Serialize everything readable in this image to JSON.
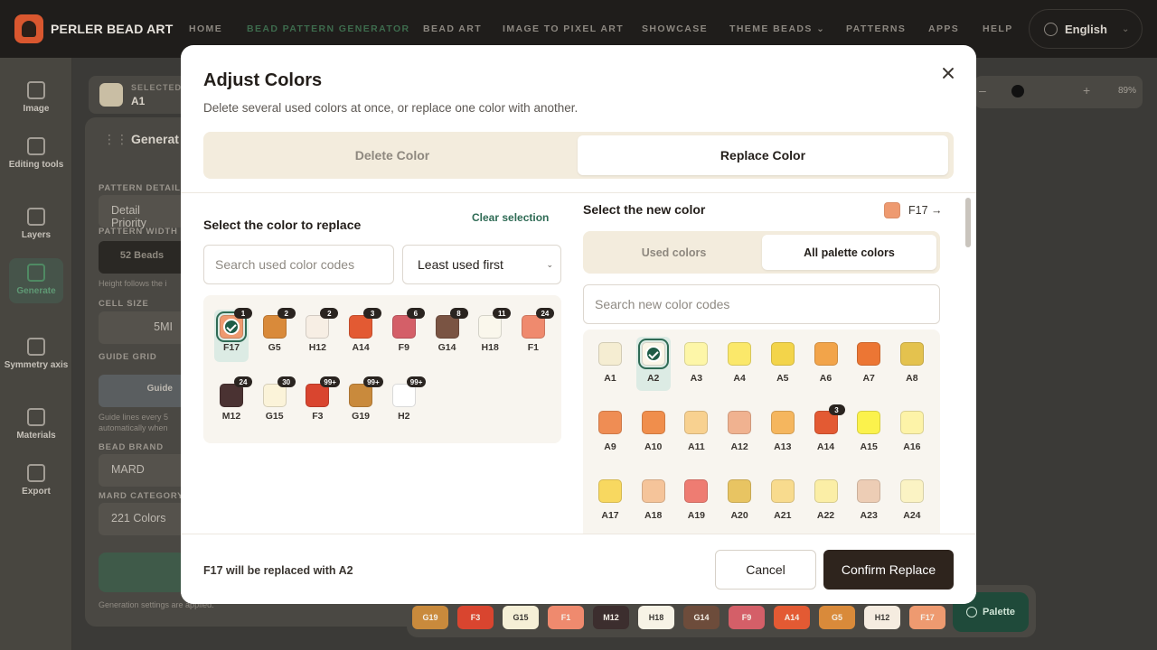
{
  "app": {
    "brand": "PERLER BEAD ART",
    "nav": [
      "HOME",
      "BEAD PATTERN GENERATOR",
      "BEAD ART",
      "IMAGE TO PIXEL ART",
      "SHOWCASE",
      "THEME BEADS",
      "PATTERNS",
      "APPS",
      "HELP"
    ],
    "nav_active": "BEAD PATTERN GENERATOR",
    "language": "English"
  },
  "sidebar": {
    "items": [
      "Image",
      "Editing tools",
      "Layers",
      "Generate",
      "Symmetry axis",
      "Materials",
      "Export"
    ]
  },
  "bg": {
    "selected_label": "SELECTED C",
    "selected_value": "A1",
    "generate_title": "Generat",
    "pattern_detail_label": "PATTERN DETAIL",
    "pattern_detail_value": "Detail Priority",
    "pattern_width_label": "PATTERN WIDTH",
    "pattern_width_value": "52 Beads",
    "height_note": "Height follows the i",
    "cell_size_label": "CELL SIZE",
    "cell_size_value": "5MI",
    "guide_grid_label": "GUIDE GRID",
    "guide_grid_value": "Guide",
    "guide_note": "Guide lines every 5 automatically when",
    "bead_brand_label": "BEAD BRAND",
    "bead_brand_value": "MARD",
    "mard_category_label": "MARD CATEGORY",
    "mard_category_value": "221 Colors",
    "applied_note": "Generation settings are applied.",
    "zoom": "89%"
  },
  "bottom_chips": [
    {
      "code": "G19",
      "color": "#c98a3c"
    },
    {
      "code": "F3",
      "color": "#d9452f"
    },
    {
      "code": "G15",
      "color": "#f5efd6"
    },
    {
      "code": "F1",
      "color": "#ef8a6e"
    },
    {
      "code": "M12",
      "color": "#3c2e2e"
    },
    {
      "code": "H18",
      "color": "#f7f3e6"
    },
    {
      "code": "G14",
      "color": "#6d4c3b"
    },
    {
      "code": "F9",
      "color": "#d45f68"
    },
    {
      "code": "A14",
      "color": "#e35a33"
    },
    {
      "code": "G5",
      "color": "#d98a3a"
    },
    {
      "code": "H12",
      "color": "#f5ece0"
    },
    {
      "code": "F17",
      "color": "#ee9a70"
    }
  ],
  "palette_button": "Palette",
  "modal": {
    "title": "Adjust Colors",
    "subtitle": "Delete several used colors at once, or replace one color with another.",
    "tabs": {
      "delete": "Delete Color",
      "replace": "Replace Color"
    },
    "left": {
      "title": "Select the color to replace",
      "clear": "Clear selection",
      "search_placeholder": "Search used color codes",
      "sort_value": "Least used first",
      "colors": [
        {
          "code": "F17",
          "count": "1",
          "color": "#ee9a70",
          "selected": true
        },
        {
          "code": "G5",
          "count": "2",
          "color": "#d98a3a"
        },
        {
          "code": "H12",
          "count": "2",
          "color": "#f7eee4"
        },
        {
          "code": "A14",
          "count": "3",
          "color": "#e35a33"
        },
        {
          "code": "F9",
          "count": "6",
          "color": "#d45f68"
        },
        {
          "code": "G14",
          "count": "8",
          "color": "#7a5443"
        },
        {
          "code": "H18",
          "count": "11",
          "color": "#faf7ec"
        },
        {
          "code": "F1",
          "count": "24",
          "color": "#ef8a6e"
        },
        {
          "code": "M12",
          "count": "24",
          "color": "#4a3232"
        },
        {
          "code": "G15",
          "count": "30",
          "color": "#fbf3d9"
        },
        {
          "code": "F3",
          "count": "99+",
          "color": "#d9452f"
        },
        {
          "code": "G19",
          "count": "99+",
          "color": "#c98a3c"
        },
        {
          "code": "H2",
          "count": "99+",
          "color": "#ffffff"
        }
      ]
    },
    "right": {
      "title": "Select the new color",
      "target": "F17 →",
      "tabs": {
        "used": "Used colors",
        "all": "All palette colors"
      },
      "search_placeholder": "Search new color codes",
      "colors": [
        {
          "code": "A1",
          "color": "#f5edd2"
        },
        {
          "code": "A2",
          "color": "#fbf6e8",
          "selected": true
        },
        {
          "code": "A3",
          "color": "#fdf6a8"
        },
        {
          "code": "A4",
          "color": "#fbe86a"
        },
        {
          "code": "A5",
          "color": "#f3d44a"
        },
        {
          "code": "A6",
          "color": "#f2a44a"
        },
        {
          "code": "A7",
          "color": "#ec7634"
        },
        {
          "code": "A8",
          "color": "#e4c24e"
        },
        {
          "code": "A9",
          "color": "#ef8d54"
        },
        {
          "code": "A10",
          "color": "#f08e4c"
        },
        {
          "code": "A11",
          "color": "#f8d190"
        },
        {
          "code": "A12",
          "color": "#f0b290"
        },
        {
          "code": "A13",
          "color": "#f5b65e"
        },
        {
          "code": "A14",
          "color": "#e35a33",
          "count": "3"
        },
        {
          "code": "A15",
          "color": "#fbf24c"
        },
        {
          "code": "A16",
          "color": "#fdf3a8"
        },
        {
          "code": "A17",
          "color": "#f8d860"
        },
        {
          "code": "A18",
          "color": "#f5c49a"
        },
        {
          "code": "A19",
          "color": "#ee7c72"
        },
        {
          "code": "A20",
          "color": "#e8c462"
        },
        {
          "code": "A21",
          "color": "#f8db8e"
        },
        {
          "code": "A22",
          "color": "#fbeea6"
        },
        {
          "code": "A23",
          "color": "#edcdb5"
        },
        {
          "code": "A24",
          "color": "#fbf3c4"
        }
      ]
    },
    "footer": {
      "message": "F17 will be replaced with A2",
      "cancel": "Cancel",
      "confirm": "Confirm Replace"
    }
  }
}
